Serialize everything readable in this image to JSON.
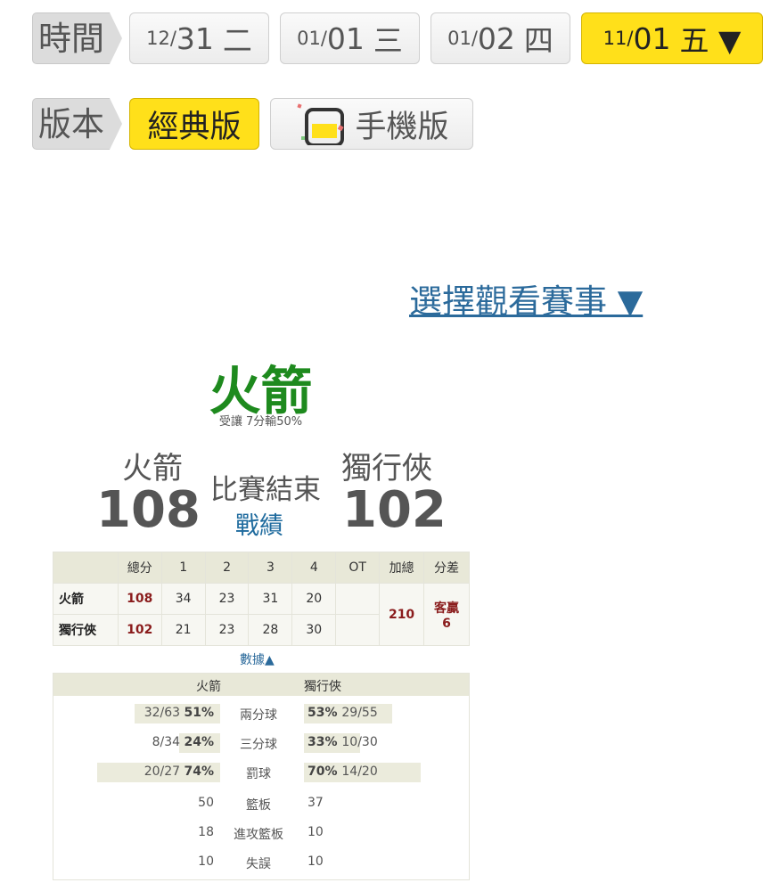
{
  "time_row": {
    "label": "時間",
    "dates": [
      {
        "md": "12/",
        "dd": "31",
        "wd": "二"
      },
      {
        "md": "01/",
        "dd": "01",
        "wd": "三"
      },
      {
        "md": "01/",
        "dd": "02",
        "wd": "四"
      },
      {
        "md": "11/",
        "dd": "01",
        "wd": "五 ▼"
      }
    ]
  },
  "version_row": {
    "label": "版本",
    "classic": "經典版",
    "mobile": "手機版"
  },
  "select_game": "選擇觀看賽事 ▼",
  "favorite": {
    "name": "火箭",
    "sub": "受讓 7分輸50%"
  },
  "game": {
    "away_name": "火箭",
    "away_score": "108",
    "home_name": "獨行俠",
    "home_score": "102",
    "status": "比賽結束",
    "result_link": "戰績"
  },
  "score_table": {
    "headers": [
      "",
      "總分",
      "1",
      "2",
      "3",
      "4",
      "OT",
      "加總",
      "分差"
    ],
    "rows": [
      {
        "team": "火箭",
        "total": "108",
        "q": [
          "34",
          "23",
          "31",
          "20"
        ],
        "ot": ""
      },
      {
        "team": "獨行俠",
        "total": "102",
        "q": [
          "21",
          "23",
          "28",
          "30"
        ],
        "ot": ""
      }
    ],
    "sum": "210",
    "diff_line1": "客贏",
    "diff_line2": "6"
  },
  "stats": {
    "toggle": "數據▲",
    "away": "火箭",
    "home": "獨行俠",
    "rows": [
      {
        "label": "兩分球",
        "away_raw": "32/63",
        "away_pct": "51%",
        "away_frac": 0.51,
        "home_pct": "53%",
        "home_raw": "29/55",
        "home_frac": 0.53
      },
      {
        "label": "三分球",
        "away_raw": "8/34",
        "away_pct": "24%",
        "away_frac": 0.24,
        "home_pct": "33%",
        "home_raw": "10/30",
        "home_frac": 0.33
      },
      {
        "label": "罰球",
        "away_raw": "20/27",
        "away_pct": "74%",
        "away_frac": 0.74,
        "home_pct": "70%",
        "home_raw": "14/20",
        "home_frac": 0.7
      },
      {
        "label": "籃板",
        "away_raw": "",
        "away_pct": "50",
        "home_pct": "37",
        "home_raw": ""
      },
      {
        "label": "進攻籃板",
        "away_raw": "",
        "away_pct": "18",
        "home_pct": "10",
        "home_raw": ""
      },
      {
        "label": "失誤",
        "away_raw": "",
        "away_pct": "10",
        "home_pct": "10",
        "home_raw": ""
      }
    ]
  },
  "colors": {
    "accent_yellow": "#ffe01a",
    "favorite_green": "#1e8a1e",
    "link_blue": "#2b6a9b",
    "score_red": "#8a1c1c"
  }
}
